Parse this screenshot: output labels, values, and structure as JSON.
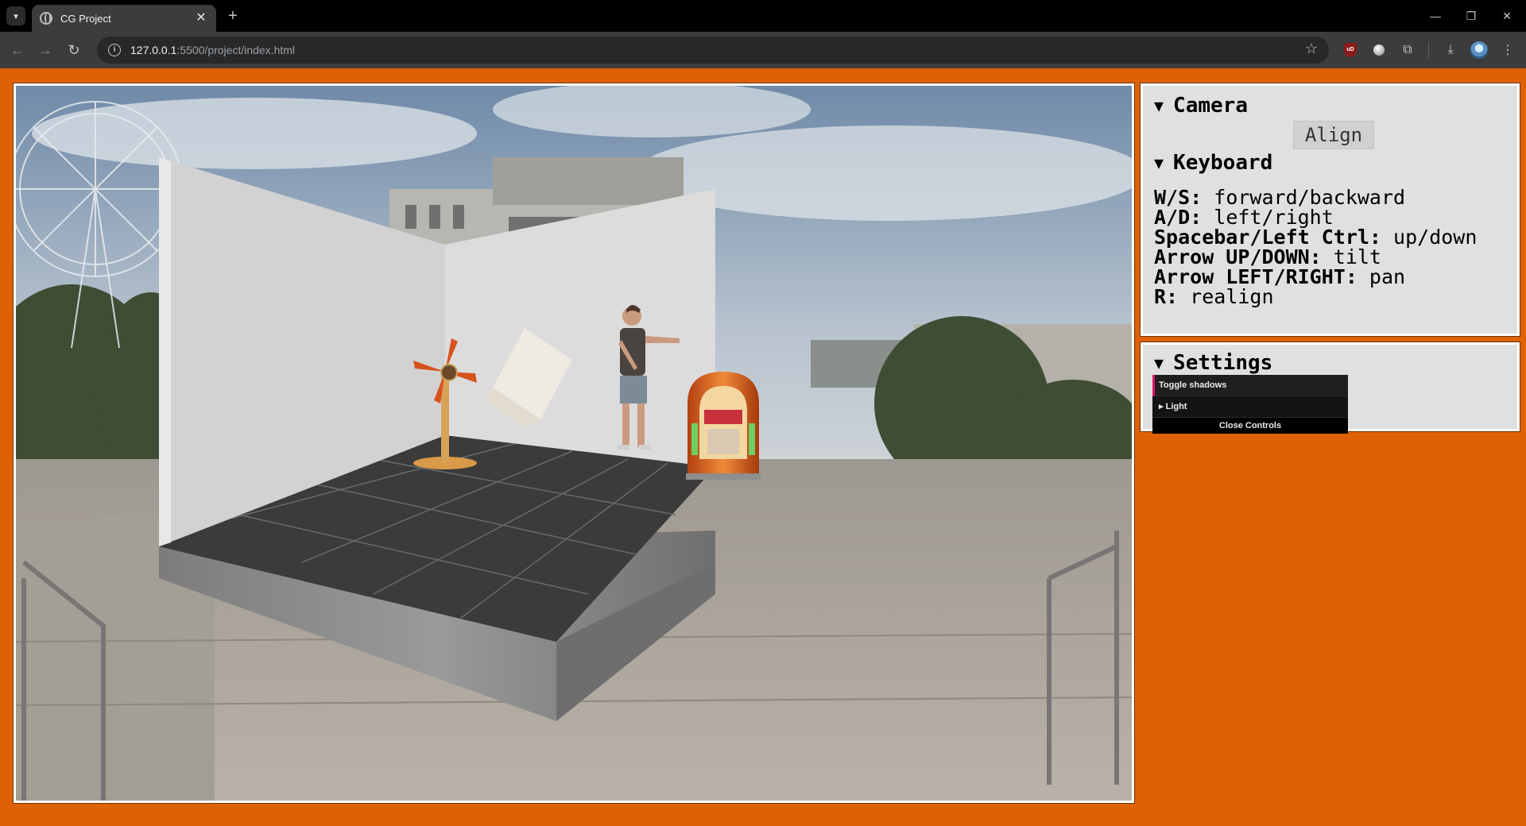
{
  "browser": {
    "tab_title": "CG Project",
    "tab_close": "✕",
    "new_tab": "+",
    "url_host": "127.0.0.1",
    "url_rest": ":5500/project/index.html",
    "window_controls": {
      "minimize": "—",
      "restore": "❐",
      "close": "✕"
    },
    "extensions": {
      "ublock_label": "uD"
    }
  },
  "panel": {
    "camera": {
      "title": "Camera",
      "align_label": "Align"
    },
    "keyboard": {
      "title": "Keyboard",
      "lines": [
        {
          "key": "W/S:",
          "desc": " forward/backward"
        },
        {
          "key": "A/D:",
          "desc": " left/right"
        },
        {
          "key": "Spacebar/Left Ctrl:",
          "desc": " up/down"
        },
        {
          "key": "Arrow UP/DOWN:",
          "desc": " tilt"
        },
        {
          "key": "Arrow LEFT/RIGHT:",
          "desc": " pan"
        },
        {
          "key": "R:",
          "desc": " realign"
        }
      ]
    },
    "settings": {
      "title": "Settings"
    }
  },
  "gui": {
    "toggle_shadows": "Toggle shadows",
    "light_folder": "Light",
    "close_controls": "Close Controls"
  },
  "icons": {
    "caret": "▼",
    "folder_caret": "▸"
  },
  "colors": {
    "page_background": "#df6106",
    "panel_background": "#e0e0e0",
    "gui_accent": "#e0136b"
  }
}
